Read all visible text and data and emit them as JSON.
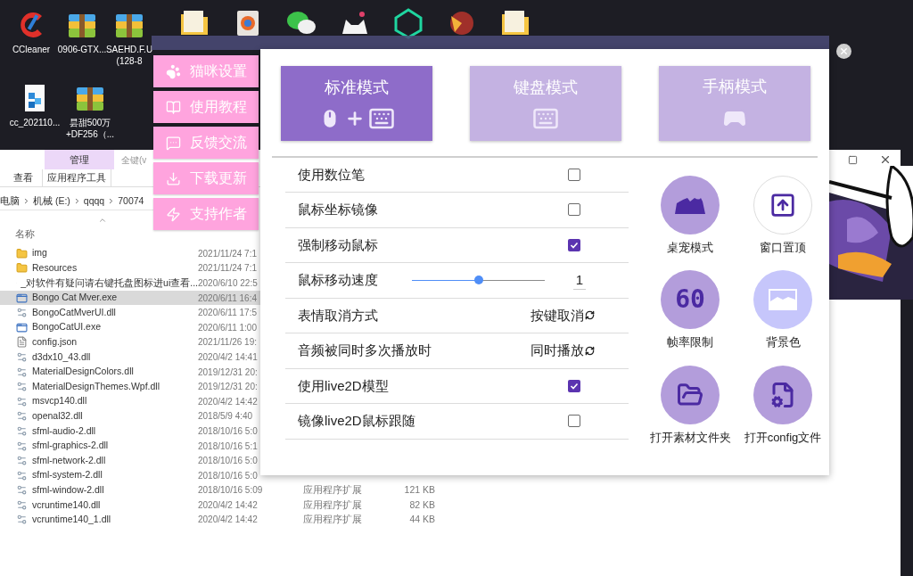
{
  "desktop": {
    "icons": [
      {
        "kind": "cleaner",
        "label": [
          "CCleaner"
        ]
      },
      {
        "kind": "archive",
        "label": [
          "0906-GTX..."
        ]
      },
      {
        "kind": "archive",
        "label": [
          "SAEHD.F.U",
          "(128-8"
        ]
      },
      {
        "kind": "folder"
      },
      {
        "kind": "document"
      },
      {
        "kind": "chat"
      },
      {
        "kind": "app"
      },
      {
        "kind": "diamond"
      },
      {
        "kind": "game"
      },
      {
        "kind": "folder"
      }
    ],
    "icons_row2": [
      {
        "kind": "registry",
        "label": [
          "cc_202110..."
        ]
      },
      {
        "kind": "archive",
        "label": [
          "昙甜500万",
          "+DF256（..."
        ]
      }
    ]
  },
  "explorer": {
    "context_tab": "管理",
    "title": "全键(v",
    "ribbon_row": [
      "查看",
      "应用程序工具"
    ],
    "breadcrumb": [
      "电脑",
      "机械 (E:)",
      "qqqq",
      "70074"
    ],
    "column": "名称",
    "files": [
      {
        "kind": "folder",
        "name": "img",
        "date": "2021/11/24 7:1",
        "selected": false
      },
      {
        "kind": "folder",
        "name": "Resources",
        "date": "2021/11/24 7:1",
        "selected": false
      },
      {
        "kind": "text",
        "name": "_对软件有疑问请右键托盘图标进ui查看...",
        "date": "2020/6/10 22:5",
        "selected": false
      },
      {
        "kind": "exe",
        "name": "Bongo Cat Mver.exe",
        "date": "2020/6/11 16:4",
        "selected": true
      },
      {
        "kind": "dll",
        "name": "BongoCatMverUI.dll",
        "date": "2020/6/11 17:5",
        "selected": false
      },
      {
        "kind": "exe",
        "name": "BongoCatUI.exe",
        "date": "2020/6/11 1:00",
        "selected": false
      },
      {
        "kind": "text",
        "name": "config.json",
        "date": "2021/11/26 19:",
        "selected": false
      },
      {
        "kind": "dll",
        "name": "d3dx10_43.dll",
        "date": "2020/4/2 14:41",
        "selected": false
      },
      {
        "kind": "dll",
        "name": "MaterialDesignColors.dll",
        "date": "2019/12/31 20:",
        "selected": false
      },
      {
        "kind": "dll",
        "name": "MaterialDesignThemes.Wpf.dll",
        "date": "2019/12/31 20:",
        "selected": false
      },
      {
        "kind": "dll",
        "name": "msvcp140.dll",
        "date": "2020/4/2 14:42",
        "selected": false
      },
      {
        "kind": "dll",
        "name": "openal32.dll",
        "date": "2018/5/9 4:40",
        "selected": false
      },
      {
        "kind": "dll",
        "name": "sfml-audio-2.dll",
        "date": "2018/10/16 5:0",
        "selected": false
      },
      {
        "kind": "dll",
        "name": "sfml-graphics-2.dll",
        "date": "2018/10/16 5:1",
        "selected": false
      },
      {
        "kind": "dll",
        "name": "sfml-network-2.dll",
        "date": "2018/10/16 5:0",
        "selected": false
      },
      {
        "kind": "dll",
        "name": "sfml-system-2.dll",
        "date": "2018/10/16 5:0",
        "selected": false
      },
      {
        "kind": "dll",
        "name": "sfml-window-2.dll",
        "date": "2018/10/16 5:09",
        "type": "应用程序扩展",
        "size": "121 KB",
        "selected": false
      },
      {
        "kind": "dll",
        "name": "vcruntime140.dll",
        "date": "2020/4/2 14:42",
        "type": "应用程序扩展",
        "size": "82 KB",
        "selected": false
      },
      {
        "kind": "dll",
        "name": "vcruntime140_1.dll",
        "date": "2020/4/2 14:42",
        "type": "应用程序扩展",
        "size": "44 KB",
        "selected": false
      }
    ]
  },
  "app": {
    "menu": [
      {
        "label": "猫咪设置"
      },
      {
        "label": "使用教程"
      },
      {
        "label": "反馈交流"
      },
      {
        "label": "下载更新"
      },
      {
        "label": "支持作者"
      }
    ],
    "modes": [
      {
        "label": "标准模式",
        "selected": true
      },
      {
        "label": "键盘模式",
        "selected": false
      },
      {
        "label": "手柄模式",
        "selected": false
      }
    ],
    "settings": [
      {
        "kind": "checkbox",
        "label": "使用数位笔",
        "checked": false
      },
      {
        "kind": "checkbox",
        "label": "鼠标坐标镜像",
        "checked": false
      },
      {
        "kind": "checkbox",
        "label": "强制移动鼠标",
        "checked": true
      },
      {
        "kind": "slider",
        "label": "鼠标移动速度",
        "level": 0.5,
        "value": "1"
      },
      {
        "kind": "cycle",
        "label": "表情取消方式",
        "value": "按键取消"
      },
      {
        "kind": "cycle",
        "label": "音频被同时多次播放时",
        "value": "同时播放"
      },
      {
        "kind": "checkbox",
        "label": "使用live2D模型",
        "checked": true
      },
      {
        "kind": "checkbox",
        "label": "镜像live2D鼠标跟随",
        "checked": false
      }
    ],
    "tools": [
      {
        "label": "桌宠模式",
        "color": "#b39ddb"
      },
      {
        "label": "窗口置顶",
        "color": "#ffffff"
      },
      {
        "badge": "60",
        "label": "帧率限制",
        "color": "#b39ddb"
      },
      {
        "label": "背景色",
        "color": "#c6c6fb"
      },
      {
        "label": "打开素材文件夹",
        "color": "#b39ddb"
      },
      {
        "label": "打开config文件",
        "color": "#b39ddb"
      }
    ]
  }
}
